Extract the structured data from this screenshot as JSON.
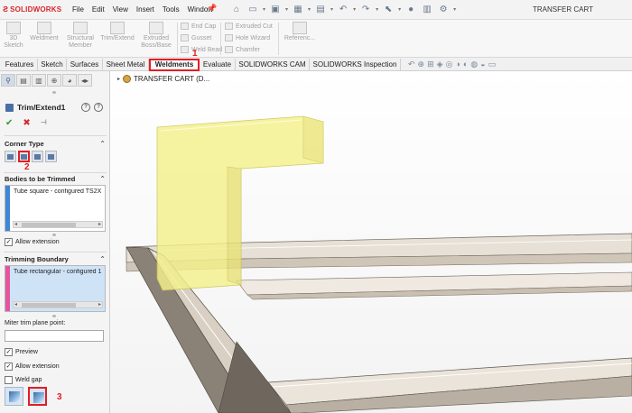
{
  "app": {
    "logo": "SOLIDWORKS",
    "document_title": "TRANSFER CART"
  },
  "menu": [
    "File",
    "Edit",
    "View",
    "Insert",
    "Tools",
    "Window"
  ],
  "quick_access_icons": [
    "home-icon",
    "new-document-icon",
    "open-icon",
    "save-icon",
    "print-icon",
    "undo-icon",
    "redo-icon",
    "select-icon",
    "rebuild-icon",
    "file-properties-icon",
    "options-icon"
  ],
  "commands": {
    "sketch3d": "3D\nSketch",
    "weldment": "Weldment",
    "structural_member": "Structural\nMember",
    "trim_extend": "Trim/Extend",
    "extruded_boss": "Extruded\nBoss/Base",
    "end_cap": "End Cap",
    "gusset": "Gusset",
    "weld_bead": "Weld Bead",
    "extruded_cut": "Extruded Cut",
    "hole_wizard": "Hole Wizard",
    "chamfer": "Chamfer",
    "reference": "Referenc..."
  },
  "tabs": [
    "Features",
    "Sketch",
    "Surfaces",
    "Sheet Metal",
    "Weldments",
    "Evaluate",
    "SOLIDWORKS CAM",
    "SOLIDWORKS Inspection"
  ],
  "active_tab": "Weldments",
  "markers": {
    "m1": "1",
    "m2": "2",
    "m3": "3"
  },
  "property_manager": {
    "feature_title": "Trim/Extend1",
    "corner_type_label": "Corner Type",
    "bodies_label": "Bodies to be Trimmed",
    "bodies_item": "Tube square - configured TS2X",
    "allow_extension_1": "Allow extension",
    "boundary_label": "Trimming Boundary",
    "boundary_item": "Tube rectangular - configured 1",
    "miter_label": "Miter trim plane point:",
    "miter_value": "",
    "preview": "Preview",
    "allow_extension_2": "Allow extension",
    "weld_gap": "Weld gap",
    "checks": {
      "allow_extension_1": true,
      "preview": true,
      "allow_extension_2": true,
      "weld_gap": false
    }
  },
  "feature_tree": {
    "root_label": "TRANSFER CART  (D..."
  },
  "colors": {
    "highlight_red": "#e31d24",
    "selection_yellow": "#f4f18c",
    "frame_tube": "#d8cfc4"
  }
}
